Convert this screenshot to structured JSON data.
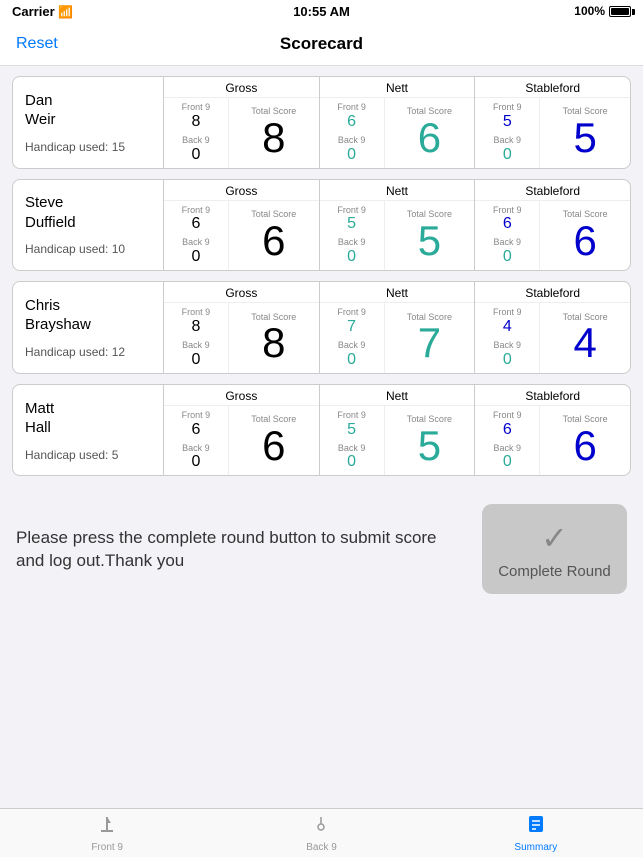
{
  "statusBar": {
    "carrier": "Carrier",
    "time": "10:55 AM",
    "battery": "100%"
  },
  "navBar": {
    "title": "Scorecard",
    "resetLabel": "Reset"
  },
  "players": [
    {
      "id": "player-1",
      "name": "Dan\nWeir",
      "handicap": "Handicap used: 15",
      "gross": {
        "header": "Gross",
        "front9Label": "Front 9",
        "front9Val": "8",
        "back9Label": "Back 9",
        "back9Val": "0",
        "totalLabel": "Total Score",
        "totalVal": "8"
      },
      "nett": {
        "header": "Nett",
        "front9Label": "Front 9",
        "front9Val": "6",
        "back9Label": "Back 9",
        "back9Val": "0",
        "totalLabel": "Total Score",
        "totalVal": "6"
      },
      "stableford": {
        "header": "Stableford",
        "front9Label": "Front 9",
        "front9Val": "5",
        "back9Label": "Back 9",
        "back9Val": "0",
        "totalLabel": "Total Score",
        "totalVal": "5"
      }
    },
    {
      "id": "player-2",
      "name": "Steve\nDuffield",
      "handicap": "Handicap used: 10",
      "gross": {
        "header": "Gross",
        "front9Label": "Front 9",
        "front9Val": "6",
        "back9Label": "Back 9",
        "back9Val": "0",
        "totalLabel": "Total Score",
        "totalVal": "6"
      },
      "nett": {
        "header": "Nett",
        "front9Label": "Front 9",
        "front9Val": "5",
        "back9Label": "Back 9",
        "back9Val": "0",
        "totalLabel": "Total Score",
        "totalVal": "5"
      },
      "stableford": {
        "header": "Stableford",
        "front9Label": "Front 9",
        "front9Val": "6",
        "back9Label": "Back 9",
        "back9Val": "0",
        "totalLabel": "Total Score",
        "totalVal": "6"
      }
    },
    {
      "id": "player-3",
      "name": "Chris\nBrayshaw",
      "handicap": "Handicap used: 12",
      "gross": {
        "header": "Gross",
        "front9Label": "Front 9",
        "front9Val": "8",
        "back9Label": "Back 9",
        "back9Val": "0",
        "totalLabel": "Total Score",
        "totalVal": "8"
      },
      "nett": {
        "header": "Nett",
        "front9Label": "Front 9",
        "front9Val": "7",
        "back9Label": "Back 9",
        "back9Val": "0",
        "totalLabel": "Total Score",
        "totalVal": "7"
      },
      "stableford": {
        "header": "Stableford",
        "front9Label": "Front 9",
        "front9Val": "4",
        "back9Label": "Back 9",
        "back9Val": "0",
        "totalLabel": "Total Score",
        "totalVal": "4"
      }
    },
    {
      "id": "player-4",
      "name": "Matt\nHall",
      "handicap": "Handicap used: 5",
      "gross": {
        "header": "Gross",
        "front9Label": "Front 9",
        "front9Val": "6",
        "back9Label": "Back 9",
        "back9Val": "0",
        "totalLabel": "Total Score",
        "totalVal": "6"
      },
      "nett": {
        "header": "Nett",
        "front9Label": "Front 9",
        "front9Val": "5",
        "back9Label": "Back 9",
        "back9Val": "0",
        "totalLabel": "Total Score",
        "totalVal": "5"
      },
      "stableford": {
        "header": "Stableford",
        "front9Label": "Front 9",
        "front9Val": "6",
        "back9Label": "Back 9",
        "back9Val": "0",
        "totalLabel": "Total Score",
        "totalVal": "6"
      }
    }
  ],
  "bottomMessage": "Please press the complete round button to submit score and log out.Thank you",
  "completeBtn": {
    "label": "Complete Round",
    "checkIcon": "✓"
  },
  "tabBar": {
    "tabs": [
      {
        "id": "front9",
        "label": "Front 9",
        "icon": "⛳",
        "active": false
      },
      {
        "id": "back9",
        "label": "Back 9",
        "icon": "📍",
        "active": false
      },
      {
        "id": "summary",
        "label": "Summary",
        "icon": "📄",
        "active": true
      }
    ]
  }
}
